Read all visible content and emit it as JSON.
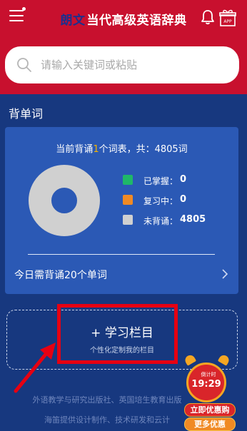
{
  "header": {
    "brand": "朗文",
    "title": "当代高级英语辞典",
    "app_badge": "APP"
  },
  "search": {
    "placeholder": "请输入关键词或粘贴"
  },
  "section": {
    "title": "背单词"
  },
  "card": {
    "summary_prefix": "当前背诵",
    "summary_count": "1",
    "summary_suffix": "个词表，共：4805词",
    "legend": [
      {
        "label": "已掌握：",
        "value": "0",
        "color": "#1fb868"
      },
      {
        "label": "复习中：",
        "value": "0",
        "color": "#f08a24"
      },
      {
        "label": "未背诵：",
        "value": "4805",
        "color": "#d0d0d0"
      }
    ],
    "daily_text": "今日需背诵20个单词"
  },
  "study": {
    "title": "学习栏目",
    "plus": "+",
    "subtitle": "个性化定制我的栏目"
  },
  "footer": {
    "line1": "外语教学与研究出版社、英国培生教育出版",
    "line2": "海笛提供设计制作、技术研发和云计"
  },
  "promo": {
    "countdown_label": "倒计时",
    "countdown_time": "19:29",
    "buy_label": "立即优惠购",
    "more_label": "更多优惠"
  },
  "colors": {
    "header": "#c8102e",
    "page": "#17387f",
    "card": "#2b59b5",
    "highlight": "#e60012"
  }
}
